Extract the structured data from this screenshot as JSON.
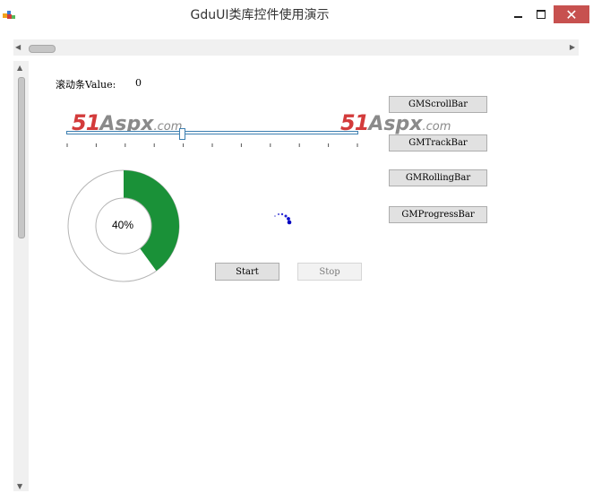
{
  "window": {
    "title": "GduUI类库控件使用演示",
    "close_glyph": "✕"
  },
  "content": {
    "value_label": "滚动条Value:",
    "value": "0",
    "watermark": {
      "num": "51",
      "brand": "Aspx",
      "suffix": ".com"
    },
    "progress": {
      "percent": 40,
      "label": "40%",
      "fill_color": "#1a9138"
    },
    "buttons": {
      "scroll": "GMScrollBar",
      "track": "GMTrackBar",
      "rolling": "GMRollingBar",
      "progress": "GMProgressBar",
      "start": "Start",
      "stop": "Stop"
    },
    "trackbar_value_fraction": 0.4
  },
  "icons": {
    "app": "app-icon",
    "minimize": "minimize-icon",
    "maximize": "maximize-icon",
    "close": "close-icon",
    "scroll_left": "arrow-left-icon",
    "scroll_right": "arrow-right-icon",
    "scroll_up": "arrow-up-icon",
    "scroll_down": "arrow-down-icon",
    "spinner": "loading-spinner-icon"
  },
  "colors": {
    "close_button": "#c7514f",
    "accent_blue": "#3c7fb1",
    "progress_green": "#1a9138"
  }
}
